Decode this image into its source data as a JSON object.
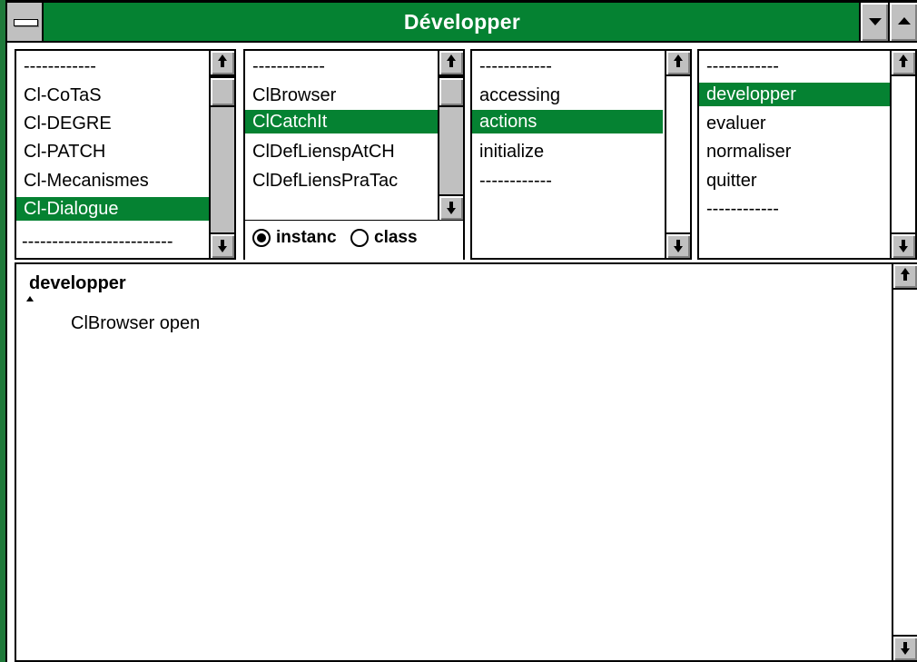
{
  "window": {
    "title": "Développer"
  },
  "icons": {
    "system_menu": "system-menu-icon",
    "minimize": "minimize-icon",
    "maximize": "maximize-icon",
    "scroll_up": "up-arrow-icon",
    "scroll_down": "down-arrow-icon"
  },
  "colors": {
    "accent": "#058232",
    "chrome": "#c0c0c0"
  },
  "categories": {
    "items": [
      "------------",
      "Cl-CoTaS",
      "Cl-DEGRE",
      "Cl-PATCH",
      "Cl-Mecanismes",
      "Cl-Dialogue",
      "-------------------------"
    ],
    "selected": "Cl-Dialogue"
  },
  "classes": {
    "items": [
      "------------",
      "ClBrowser",
      "ClCatchIt",
      "ClDefLienspAtCH",
      "ClDefLiensPraTac"
    ],
    "selected": "ClCatchIt"
  },
  "protocols": {
    "items": [
      "------------",
      "accessing",
      "actions",
      "initialize",
      "------------"
    ],
    "selected": "actions"
  },
  "methods": {
    "items": [
      "------------",
      "developper",
      "evaluer",
      "normaliser",
      "quitter",
      "------------"
    ],
    "selected": "developper"
  },
  "mode": {
    "instance_label": "instanc",
    "class_label": "class",
    "selected": "instance"
  },
  "code": {
    "method_name": "developper",
    "body": "ClBrowser open"
  }
}
